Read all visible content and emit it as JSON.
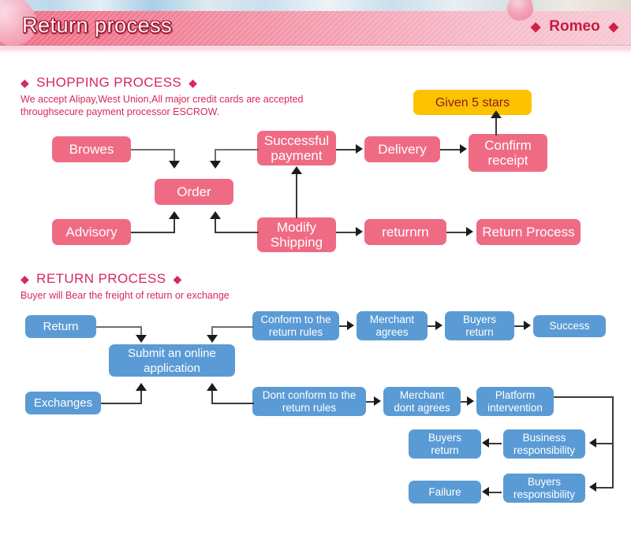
{
  "header": {
    "title": "Return process",
    "brand": "Romeo",
    "diamond": "◆"
  },
  "shopping": {
    "heading": "SHOPPING PROCESS",
    "description": "We accept Alipay,West Union,All major credit cards are accepted\nthroughsecure payment processor ESCROW.",
    "nodes": {
      "browes": "Browes",
      "order": "Order",
      "advisory": "Advisory",
      "successful_payment": "Successful\npayment",
      "modify_shipping": "Modify\nShipping",
      "delivery": "Delivery",
      "confirm_receipt": "Confirm\nreceipt",
      "given_5_stars": "Given 5 stars",
      "returnrn": "returnrn",
      "return_process": "Return Process"
    }
  },
  "returns": {
    "heading": "RETURN PROCESS",
    "description": "Buyer will Bear the freight of return or exchange",
    "nodes": {
      "return": "Return",
      "exchanges": "Exchanges",
      "submit_application": "Submit an online\napplication",
      "conform_rules": "Conform to the\nreturn rules",
      "merchant_agrees": "Merchant\nagrees",
      "buyers_return_top": "Buyers\nreturn",
      "success": "Success",
      "dont_conform_rules": "Dont conform to the\nreturn rules",
      "merchant_dont_agrees": "Merchant\ndont agrees",
      "platform_intervention": "Platform\nintervention",
      "business_responsibility": "Business\nresponsibility",
      "buyers_return_mid": "Buyers\nreturn",
      "buyers_responsibility": "Buyers\nresponsibility",
      "failure": "Failure"
    }
  },
  "colors": {
    "pink": "#ef6b84",
    "blue": "#5b9bd5",
    "gold": "#fcc200",
    "heading_red": "#d6295a",
    "brand_red": "#c71b3f"
  }
}
